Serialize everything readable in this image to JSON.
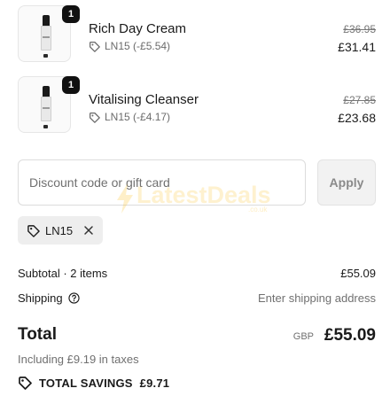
{
  "cart_items": [
    {
      "quantity": "1",
      "name": "Rich Day Cream",
      "discount_text": "LN15 (-£5.54)",
      "original_price": "£36.95",
      "sale_price": "£31.41",
      "thumbnail_icon": "cream-bottle-icon"
    },
    {
      "quantity": "1",
      "name": "Vitalising Cleanser",
      "discount_text": "LN15 (-£4.17)",
      "original_price": "£27.85",
      "sale_price": "£23.68",
      "thumbnail_icon": "cleanser-bottle-icon"
    }
  ],
  "discount": {
    "placeholder": "Discount code or gift card",
    "value": "",
    "apply_label": "Apply",
    "applied_code": "LN15"
  },
  "watermark": {
    "text": "LatestDeals",
    "sub": ".co.uk"
  },
  "summary": {
    "subtotal_label": "Subtotal · 2 items",
    "subtotal_value": "£55.09",
    "shipping_label": "Shipping",
    "shipping_value": "Enter shipping address",
    "total_label": "Total",
    "currency": "GBP",
    "total_value": "£55.09",
    "taxes_text": "Including £9.19 in taxes",
    "savings_label": "TOTAL SAVINGS",
    "savings_value": "£9.71"
  },
  "colors": {
    "badge": "#111111",
    "muted_text": "#707070",
    "chip_bg": "#eeeeee",
    "watermark": "#fbbf24"
  }
}
